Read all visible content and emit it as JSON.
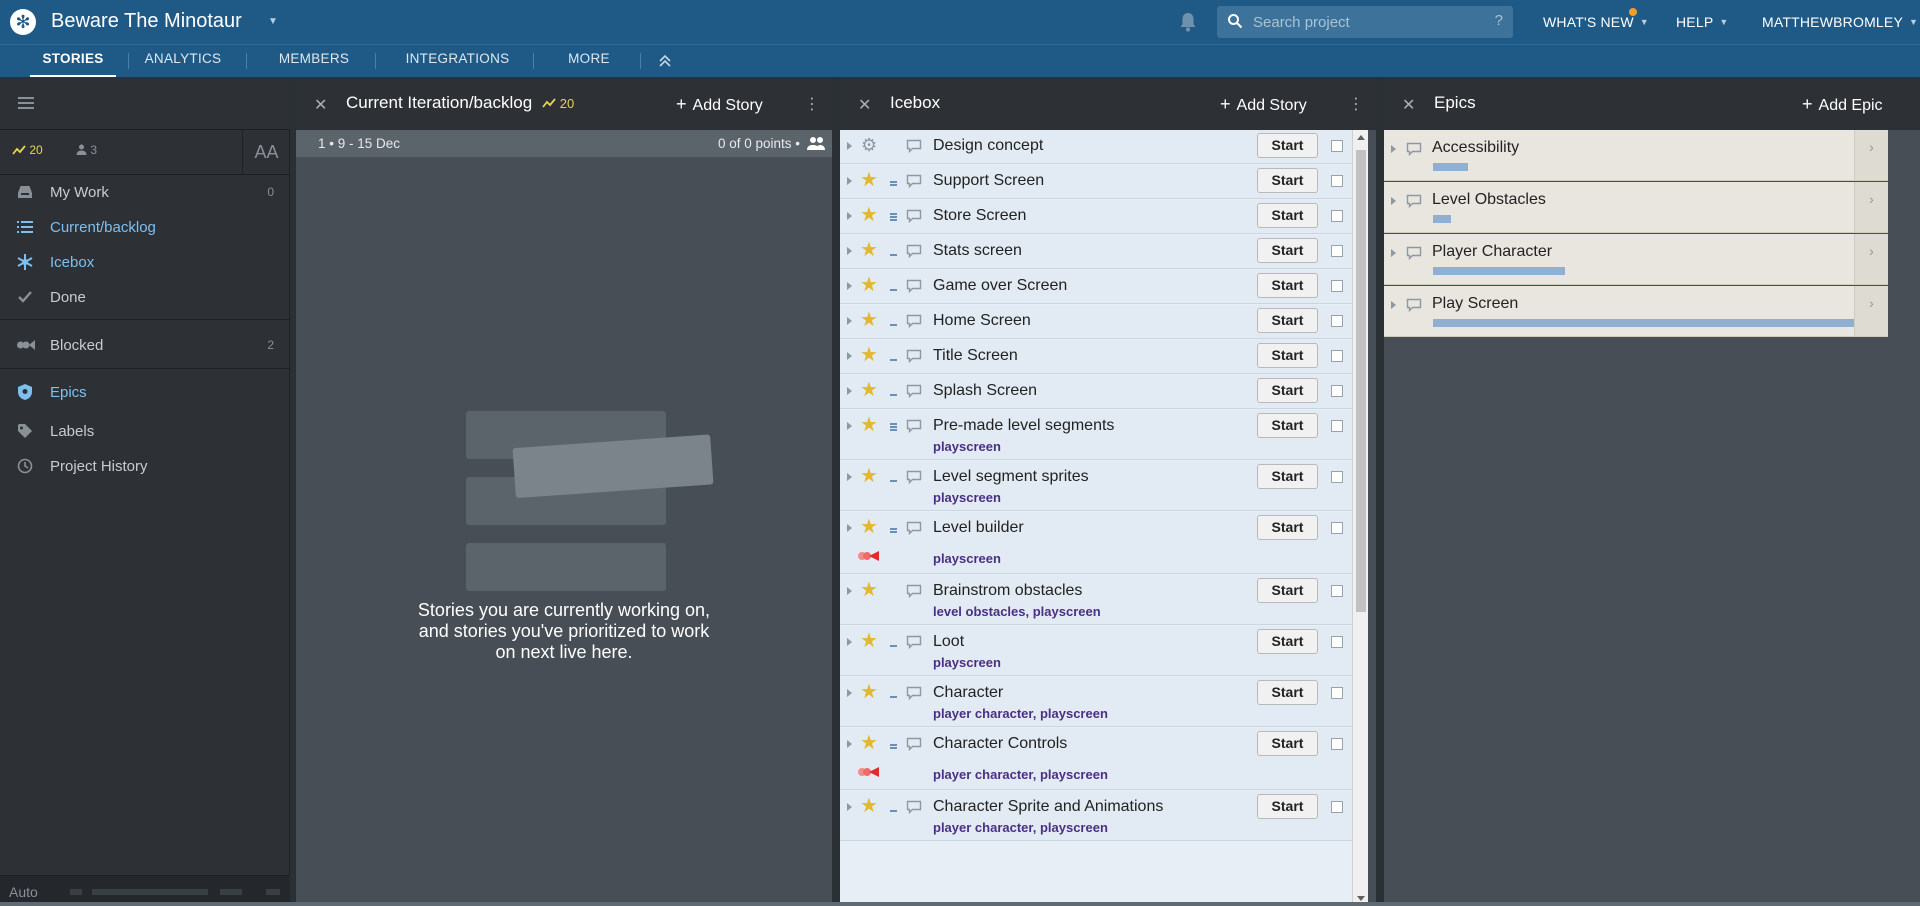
{
  "app": {
    "project_title": "Beware The Minotaur",
    "search_placeholder": "Search project",
    "search_help": "?",
    "nav": {
      "whats_new": "WHAT'S NEW",
      "help": "HELP",
      "user": "MATTHEWBROMLEY"
    },
    "tabs": [
      "STORIES",
      "ANALYTICS",
      "MEMBERS",
      "INTEGRATIONS",
      "MORE"
    ],
    "colors": {
      "header": "#1f5a87",
      "accent": "#e8d44c",
      "link": "#7ebff0",
      "label": "#4b2f85"
    }
  },
  "sidebar": {
    "velocity": "20",
    "people": "3",
    "text_size": "AA",
    "items": [
      {
        "label": "My Work",
        "count": "0",
        "icon": "inbox-icon"
      },
      {
        "label": "Current/backlog",
        "count": "",
        "icon": "list-icon"
      },
      {
        "label": "Icebox",
        "count": "",
        "icon": "snowflake-icon"
      },
      {
        "label": "Done",
        "count": "",
        "icon": "check-icon"
      },
      {
        "label": "Blocked",
        "count": "2",
        "icon": "blocked-icon"
      },
      {
        "label": "Epics",
        "count": "",
        "icon": "shield-icon"
      },
      {
        "label": "Labels",
        "count": "",
        "icon": "tag-icon"
      },
      {
        "label": "Project History",
        "count": "",
        "icon": "clock-icon"
      }
    ],
    "footer": "Auto"
  },
  "current": {
    "title": "Current Iteration/backlog",
    "velocity": "20",
    "add_label": "Add Story",
    "iteration": "1 • 9 - 15 Dec",
    "points": "0 of 0 points •",
    "empty_line1": "Stories you are currently working on,",
    "empty_line2": "and stories you've prioritized to work",
    "empty_line3": "on next live here."
  },
  "icebox": {
    "title": "Icebox",
    "add_label": "Add Story",
    "start_label": "Start",
    "stories": [
      {
        "name": "Design concept",
        "labels": "",
        "icon": "gear",
        "est": 0,
        "blocked": false
      },
      {
        "name": "Support Screen",
        "labels": "",
        "icon": "star",
        "est": 2,
        "blocked": false
      },
      {
        "name": "Store Screen",
        "labels": "",
        "icon": "star",
        "est": 3,
        "blocked": false
      },
      {
        "name": "Stats screen",
        "labels": "",
        "icon": "star",
        "est": 1,
        "blocked": false
      },
      {
        "name": "Game over Screen",
        "labels": "",
        "icon": "star",
        "est": 1,
        "blocked": false
      },
      {
        "name": "Home Screen",
        "labels": "",
        "icon": "star",
        "est": 1,
        "blocked": false
      },
      {
        "name": "Title Screen",
        "labels": "",
        "icon": "star",
        "est": 1,
        "blocked": false
      },
      {
        "name": "Splash Screen",
        "labels": "",
        "icon": "star",
        "est": 1,
        "blocked": false
      },
      {
        "name": "Pre-made level segments",
        "labels": "playscreen",
        "icon": "star",
        "est": 3,
        "blocked": false
      },
      {
        "name": "Level segment sprites",
        "labels": "playscreen",
        "icon": "star",
        "est": 1,
        "blocked": false
      },
      {
        "name": "Level builder",
        "labels": "playscreen",
        "icon": "star",
        "est": 2,
        "blocked": true
      },
      {
        "name": "Brainstrom obstacles",
        "labels": "level obstacles, playscreen",
        "icon": "star",
        "est": 0,
        "blocked": false
      },
      {
        "name": "Loot",
        "labels": "playscreen",
        "icon": "star",
        "est": 1,
        "blocked": false
      },
      {
        "name": "Character",
        "labels": "player character, playscreen",
        "icon": "star",
        "est": 1,
        "blocked": false
      },
      {
        "name": "Character Controls",
        "labels": "player character, playscreen",
        "icon": "star",
        "est": 2,
        "blocked": true
      },
      {
        "name": "Character Sprite and Animations",
        "labels": "player character, playscreen",
        "icon": "star",
        "est": 1,
        "blocked": false
      }
    ]
  },
  "epics": {
    "title": "Epics",
    "add_label": "Add Epic",
    "items": [
      {
        "name": "Accessibility",
        "progress": 0.08
      },
      {
        "name": "Level Obstacles",
        "progress": 0.04
      },
      {
        "name": "Player Character",
        "progress": 0.3
      },
      {
        "name": "Play Screen",
        "progress": 1.0
      }
    ]
  }
}
